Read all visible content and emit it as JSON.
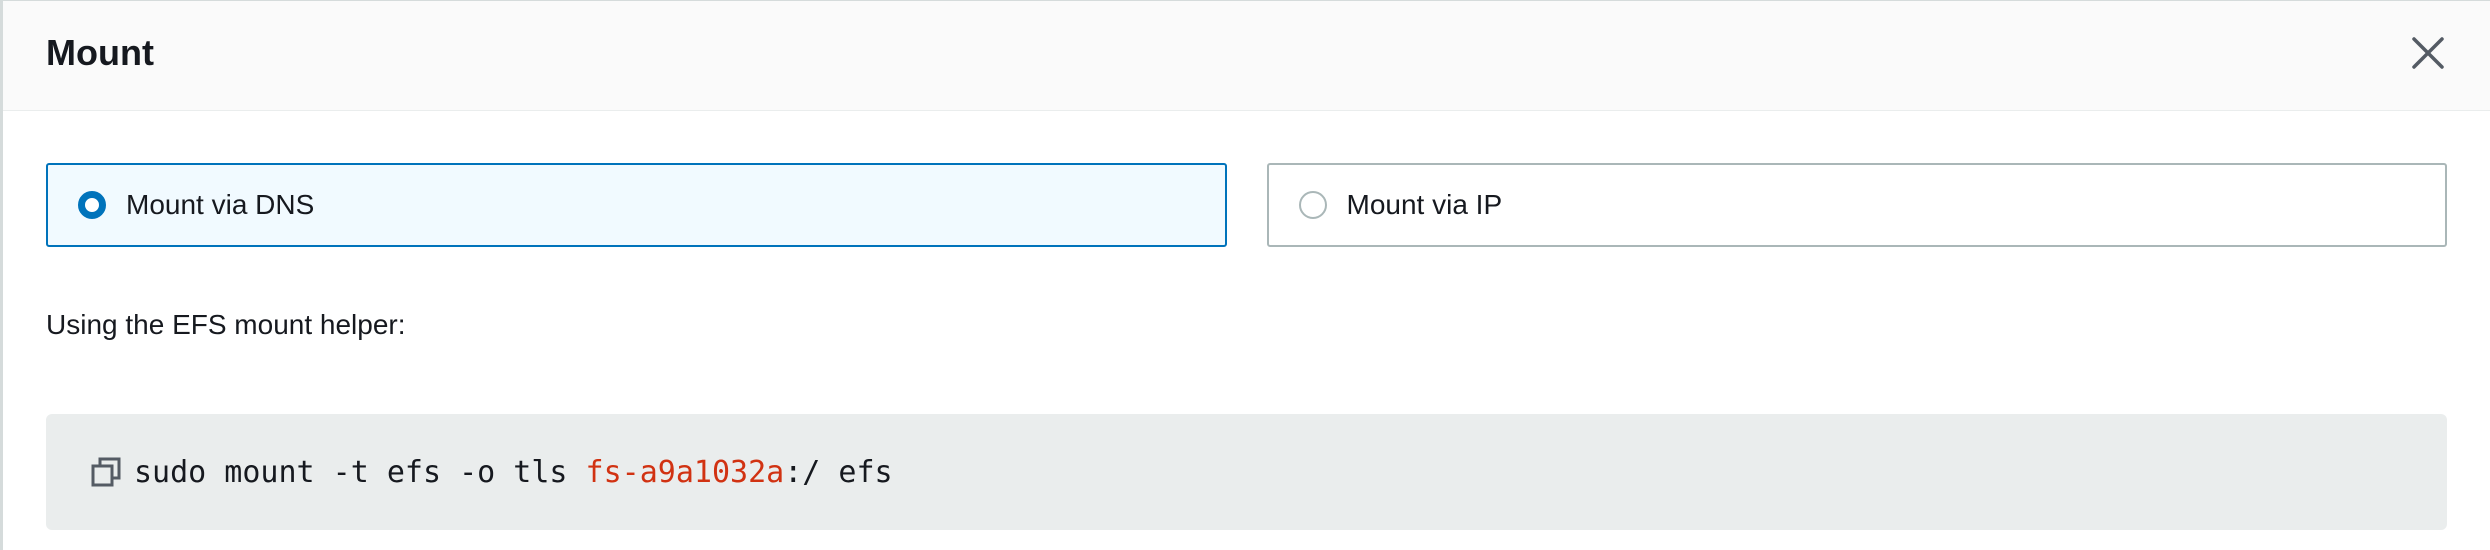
{
  "modal": {
    "title": "Mount",
    "close_icon": "close-icon"
  },
  "radio_options": [
    {
      "label": "Mount via DNS",
      "selected": true
    },
    {
      "label": "Mount via IP",
      "selected": false
    }
  ],
  "helper": {
    "text": "Using the EFS mount helper:"
  },
  "command": {
    "copy_icon": "copy-icon",
    "prefix": "sudo mount -t efs -o tls ",
    "filesystem_id": "fs-a9a1032a",
    "suffix": ":/ efs"
  },
  "colors": {
    "accent": "#0073bb",
    "selected_bg": "#f1faff",
    "code_bg": "#eaeded",
    "code_highlight": "#d13212"
  }
}
